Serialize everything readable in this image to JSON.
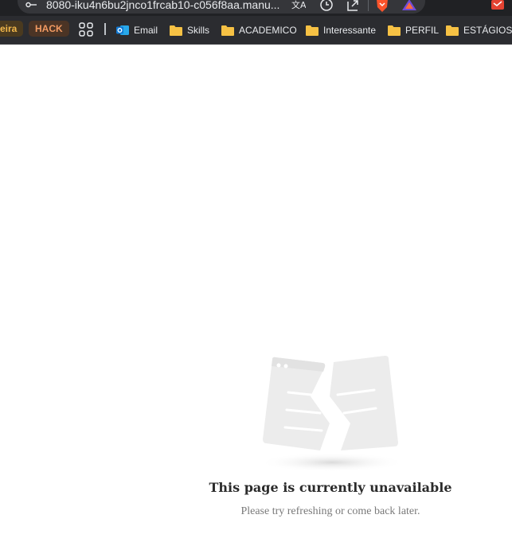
{
  "browser": {
    "url": "8080-iku4n6bu2jnco1frcab10-c056f8aa.manu...",
    "bookmarks": {
      "pill_a": "eira",
      "pill_b": "HACK",
      "items": [
        {
          "label": "Email",
          "icon": "outlook-icon"
        },
        {
          "label": "Skills",
          "icon": "folder-icon"
        },
        {
          "label": "ACADEMICO",
          "icon": "folder-icon"
        },
        {
          "label": "Interessante",
          "icon": "folder-icon"
        },
        {
          "label": "PERFIL",
          "icon": "folder-icon"
        },
        {
          "label": "ESTÁGIOS",
          "icon": "folder-icon"
        }
      ]
    },
    "colors": {
      "chrome": "#202124",
      "folder": "#f6c144",
      "outlook": "#0f78d4",
      "brave": "#fb542b"
    }
  },
  "page": {
    "title": "This page is currently unavailable",
    "subtitle": "Please try refreshing or come back later."
  }
}
